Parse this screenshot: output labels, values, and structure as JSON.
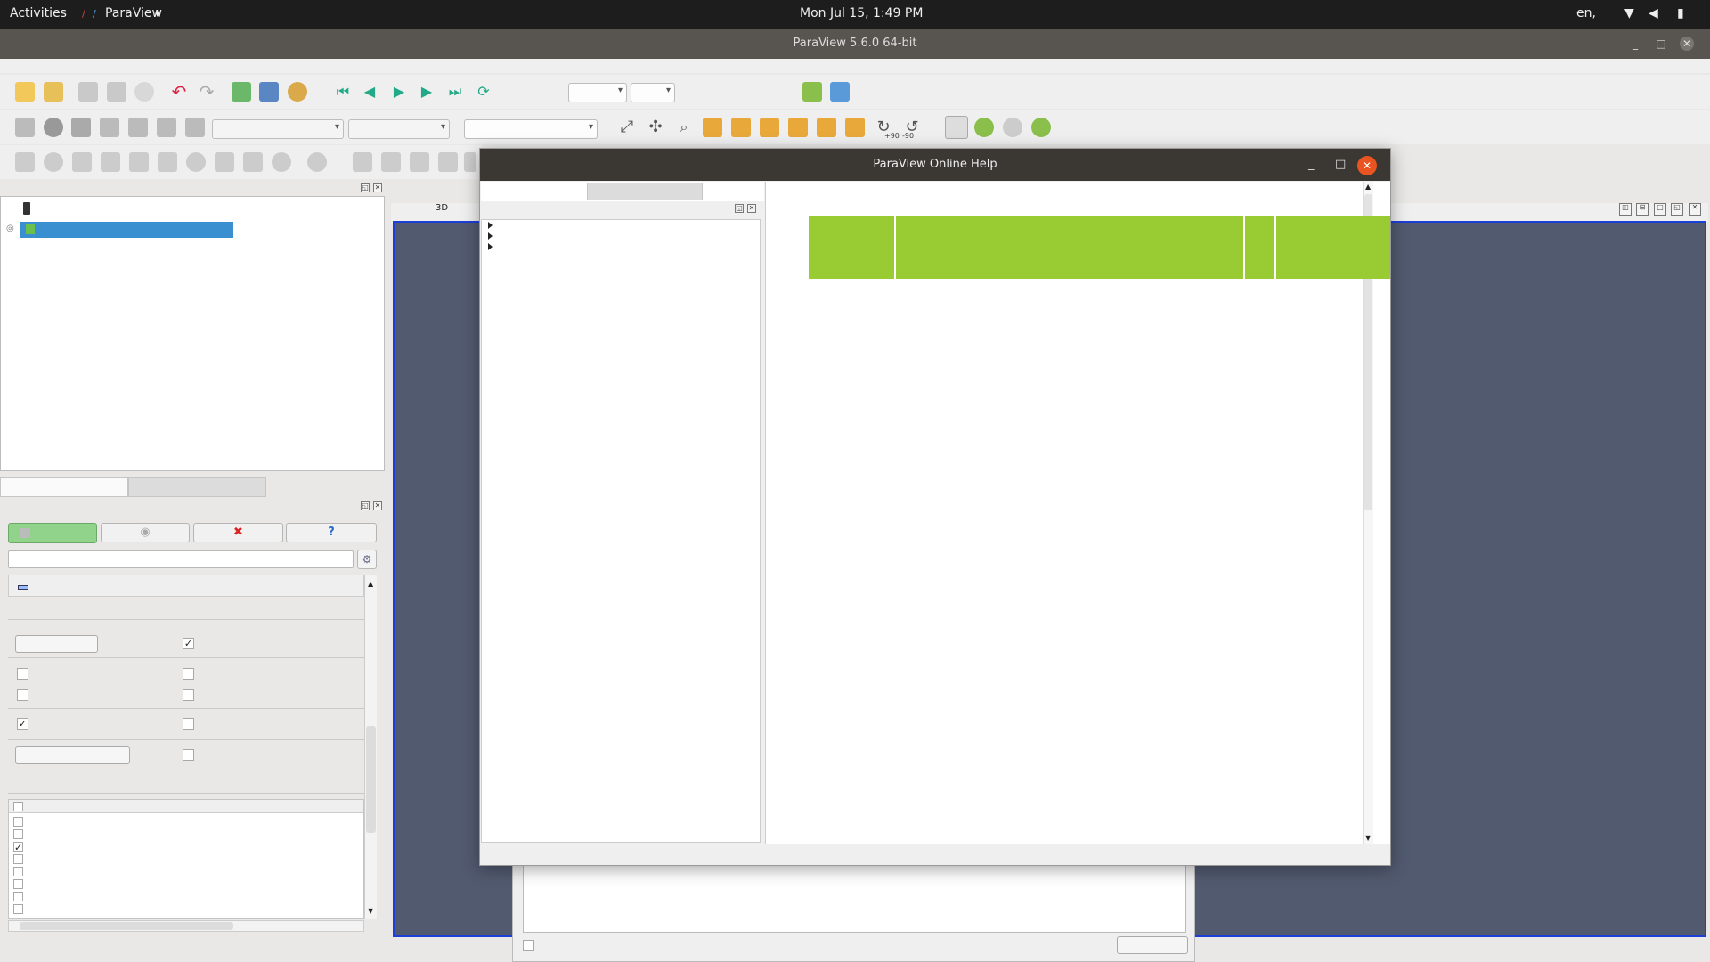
{
  "topbar": {
    "activities": "Activities",
    "app_name": "ParaView",
    "app_menu_arrow": "▾",
    "clock": "Mon Jul 15,  1:49 PM",
    "lang": "en,"
  },
  "main_window": {
    "title": "ParaView 5.6.0 64-bit",
    "minimize": "_",
    "maximize": "□",
    "close": "✕"
  },
  "toolbar": {
    "view3d_label": "3D",
    "rotate_plus": "+90",
    "rotate_minus": "-90",
    "axes": [
      "+X",
      "-X",
      "+Y",
      "-Y",
      "+Z",
      "-Z"
    ]
  },
  "properties": {
    "help_button": "?"
  },
  "help_window": {
    "title": "ParaView Online Help",
    "minimize": "_",
    "maximize": "□",
    "close": "✕"
  },
  "colors": {
    "accent_orange": "#e95420",
    "selection_blue": "#3a8fd0",
    "viewport": "#525a70",
    "apply_green": "#92d38b",
    "help_green": "#99cc33"
  }
}
